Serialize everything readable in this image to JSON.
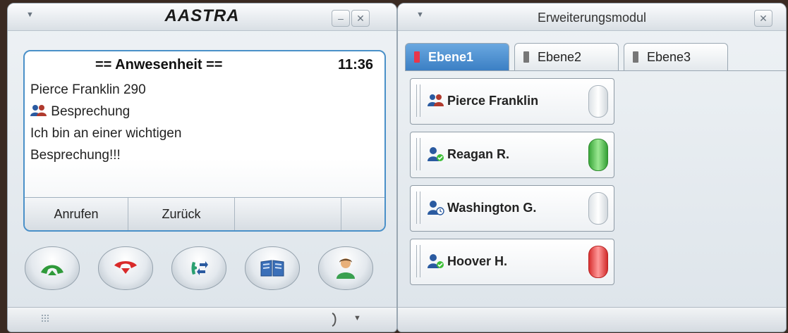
{
  "phone": {
    "logo": "AASTRA",
    "display": {
      "header": "== Anwesenheit ==",
      "time": "11:36",
      "lines": [
        "Pierce Franklin 290",
        "Besprechung",
        "Ich bin an einer wichtigen",
        "Besprechung!!!"
      ]
    },
    "softkeys": [
      "Anrufen",
      "Zurück",
      "",
      ""
    ],
    "buttons": [
      "call-accept-icon",
      "call-end-icon",
      "transfer-icon",
      "phonebook-icon",
      "contact-icon"
    ]
  },
  "module": {
    "title": "Erweiterungsmodul",
    "tabs": [
      {
        "label": "Ebene1",
        "active": true,
        "marker_color": "#e8364a"
      },
      {
        "label": "Ebene2",
        "active": false,
        "marker_color": "#777777"
      },
      {
        "label": "Ebene3",
        "active": false,
        "marker_color": "#777777"
      }
    ],
    "items": [
      {
        "name": "Pierce Franklin",
        "icon": "group-icon",
        "lamp": "off"
      },
      {
        "name": "Reagan R.",
        "icon": "user-available-icon",
        "lamp": "green"
      },
      {
        "name": "Washington G.",
        "icon": "user-away-icon",
        "lamp": "off"
      },
      {
        "name": "Hoover H.",
        "icon": "user-available-icon",
        "lamp": "red"
      }
    ]
  },
  "colors": {
    "accent": "#4a90c8",
    "lamp_green": "#3fbf3a",
    "lamp_red": "#e8383a"
  }
}
